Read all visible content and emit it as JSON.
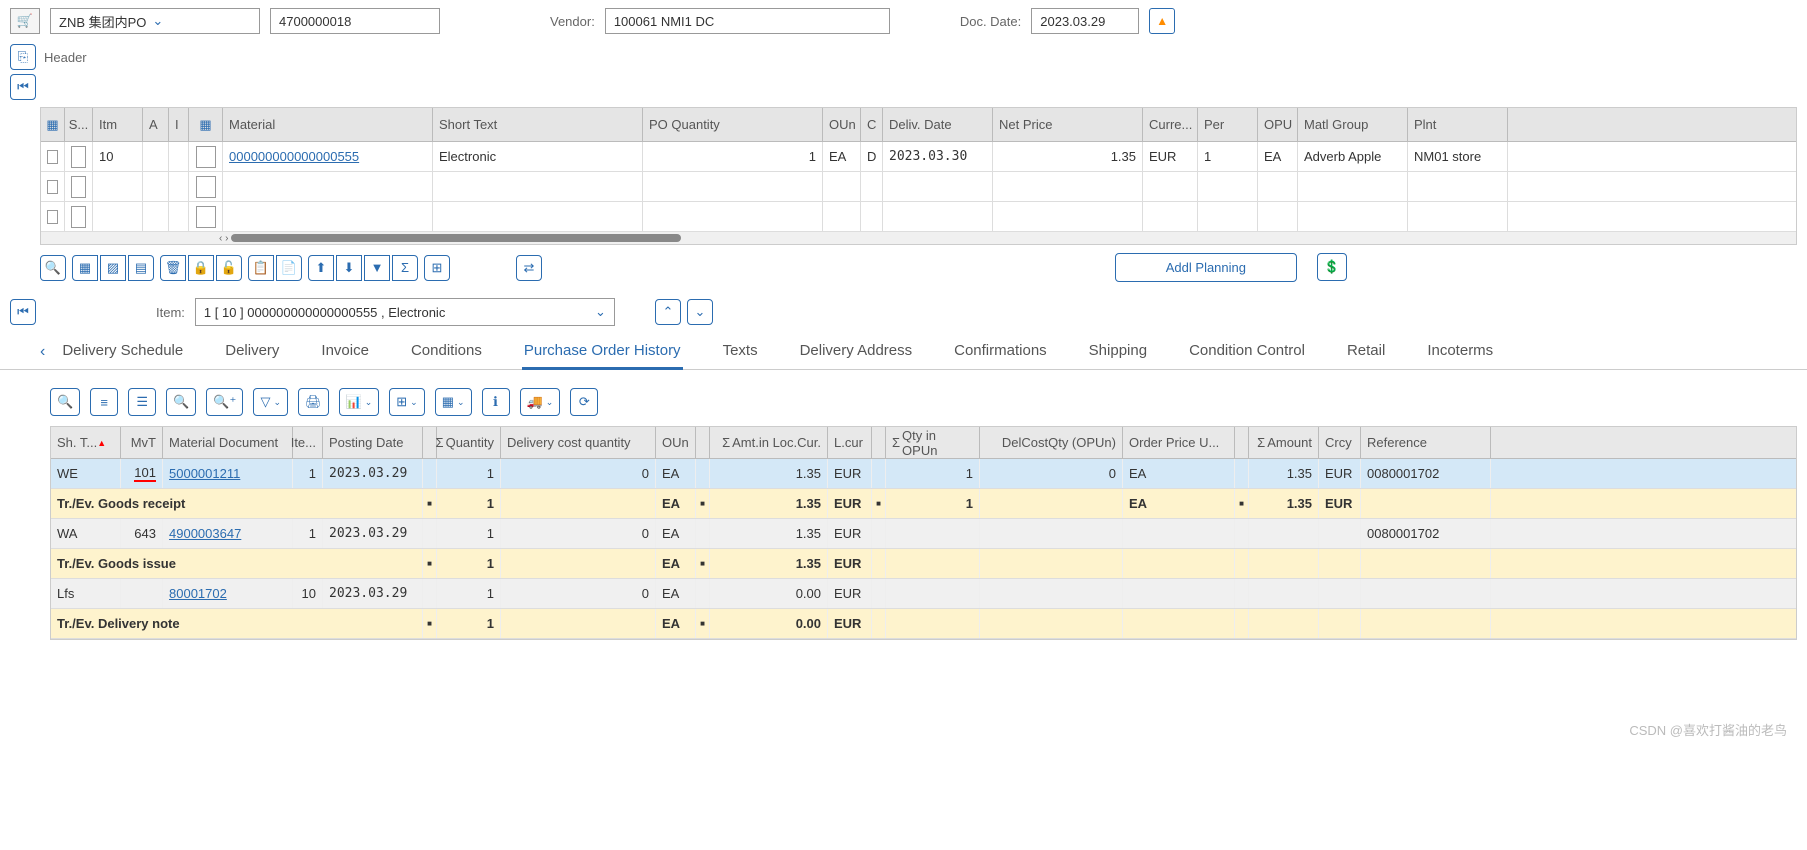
{
  "top": {
    "po_type": "ZNB 集团内PO",
    "po_number": "4700000018",
    "vendor_label": "Vendor:",
    "vendor": "100061 NMI1 DC",
    "doc_date_label": "Doc. Date:",
    "doc_date": "2023.03.29"
  },
  "header_label": "Header",
  "items": {
    "headers": {
      "s": "S...",
      "itm": "Itm",
      "a": "A",
      "i": "I",
      "material": "Material",
      "short_text": "Short Text",
      "po_qty": "PO Quantity",
      "oun": "OUn",
      "c": "C",
      "deliv_date": "Deliv. Date",
      "net_price": "Net Price",
      "curr": "Curre...",
      "per": "Per",
      "opu": "OPU",
      "matl_group": "Matl Group",
      "plnt": "Plnt"
    },
    "row": {
      "itm": "10",
      "material": "000000000000000555",
      "short_text": "Electronic",
      "qty": "1",
      "oun": "EA",
      "c": "D",
      "deliv_date": "2023.03.30",
      "net_price": "1.35",
      "curr": "EUR",
      "per": "1",
      "opu": "EA",
      "matl_group": "Adverb Apple",
      "plnt": "NM01 store"
    }
  },
  "addl_planning": "Addl Planning",
  "item_selector": {
    "label": "Item:",
    "value": "1 [ 10 ] 000000000000000555 , Electronic"
  },
  "tabs": [
    "Delivery Schedule",
    "Delivery",
    "Invoice",
    "Conditions",
    "Purchase Order History",
    "Texts",
    "Delivery Address",
    "Confirmations",
    "Shipping",
    "Condition Control",
    "Retail",
    "Incoterms"
  ],
  "active_tab_index": 4,
  "hist": {
    "headers": {
      "sh": "Sh. T...",
      "mvt": "MvT",
      "md": "Material Document",
      "ite": "Ite...",
      "pd": "Posting Date",
      "qty": "Quantity",
      "dcq": "Delivery cost quantity",
      "oun": "OUn",
      "alc": "Amt.in Loc.Cur.",
      "lcur": "L.cur",
      "qop": "Qty in OPUn",
      "dco": "DelCostQty (OPUn)",
      "opu": "Order Price U...",
      "amt": "Amount",
      "crcy": "Crcy",
      "ref": "Reference"
    },
    "rows": [
      {
        "type": "blue",
        "sh": "WE",
        "mvt": "101",
        "md": "5000001211",
        "ite": "1",
        "pd": "2023.03.29",
        "qty": "1",
        "dcq": "0",
        "oun": "EA",
        "alc": "1.35",
        "lcur": "EUR",
        "qop": "1",
        "dco": "0",
        "opu": "EA",
        "amt": "1.35",
        "crcy": "EUR",
        "ref": "0080001702",
        "link": true,
        "redmvt": true
      },
      {
        "type": "yellow",
        "sh": "Tr./Ev. Goods receipt",
        "qty": "1",
        "oun": "EA",
        "alc": "1.35",
        "lcur": "EUR",
        "qop": "1",
        "opu": "EA",
        "amt": "1.35",
        "crcy": "EUR"
      },
      {
        "type": "gray",
        "sh": "WA",
        "mvt": "643",
        "md": "4900003647",
        "ite": "1",
        "pd": "2023.03.29",
        "qty": "1",
        "dcq": "0",
        "oun": "EA",
        "alc": "1.35",
        "lcur": "EUR",
        "ref": "0080001702",
        "link": true
      },
      {
        "type": "yellow",
        "sh": "Tr./Ev. Goods issue",
        "qty": "1",
        "oun": "EA",
        "alc": "1.35",
        "lcur": "EUR"
      },
      {
        "type": "gray",
        "sh": "Lfs",
        "md": "80001702",
        "ite": "10",
        "pd": "2023.03.29",
        "qty": "1",
        "dcq": "0",
        "oun": "EA",
        "alc": "0.00",
        "lcur": "EUR",
        "link": true
      },
      {
        "type": "yellow",
        "sh": "Tr./Ev. Delivery note",
        "qty": "1",
        "oun": "EA",
        "alc": "0.00",
        "lcur": "EUR"
      }
    ]
  },
  "watermark": "CSDN @喜欢打酱油的老鸟"
}
